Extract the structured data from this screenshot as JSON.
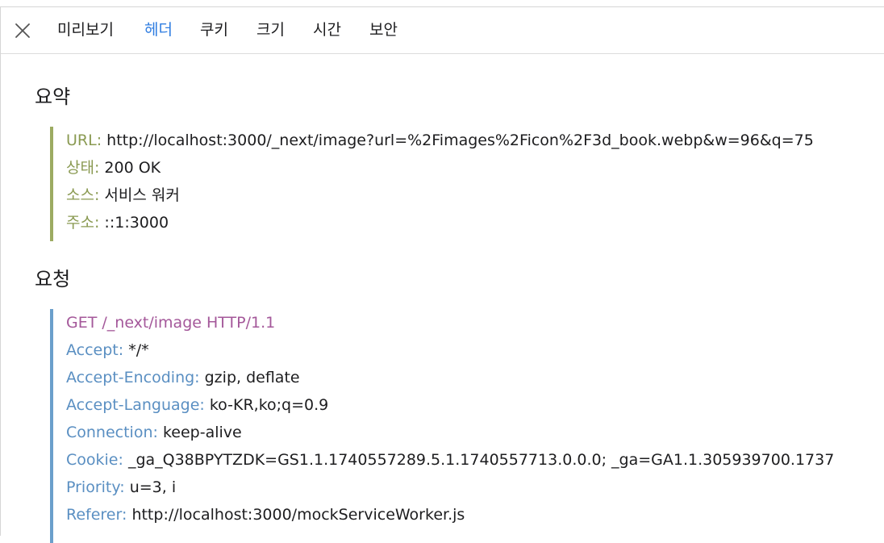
{
  "tabs": {
    "close_label": "Close",
    "preview": "미리보기",
    "headers": "헤더",
    "cookies": "쿠키",
    "size": "크기",
    "timing": "시간",
    "security": "보안",
    "active": "headers"
  },
  "summary": {
    "title": "요약",
    "rows": [
      {
        "key": "URL:",
        "value": "http://localhost:3000/_next/image?url=%2Fimages%2Ficon%2F3d_book.webp&w=96&q=75"
      },
      {
        "key": "상태:",
        "value": "200 OK"
      },
      {
        "key": "소스:",
        "value": "서비스 워커"
      },
      {
        "key": "주소:",
        "value": "::1:3000"
      }
    ]
  },
  "request": {
    "title": "요청",
    "request_line": "GET /_next/image HTTP/1.1",
    "headers": [
      {
        "key": "Accept:",
        "value": "*/*"
      },
      {
        "key": "Accept-Encoding:",
        "value": "gzip, deflate"
      },
      {
        "key": "Accept-Language:",
        "value": "ko-KR,ko;q=0.9"
      },
      {
        "key": "Connection:",
        "value": "keep-alive"
      },
      {
        "key": "Cookie:",
        "value": "_ga_Q38BPYTZDK=GS1.1.1740557289.5.1.1740557713.0.0.0; _ga=GA1.1.305939700.1737"
      },
      {
        "key": "Priority:",
        "value": "u=3, i"
      },
      {
        "key": "Referer:",
        "value": "http://localhost:3000/mockServiceWorker.js"
      }
    ]
  },
  "colors": {
    "active_tab": "#2f7de1",
    "summary_accent": "#9cab62",
    "summary_key": "#8a9a52",
    "request_accent": "#6b9fcb",
    "request_key": "#5a8fc2",
    "request_line": "#a4589a"
  }
}
